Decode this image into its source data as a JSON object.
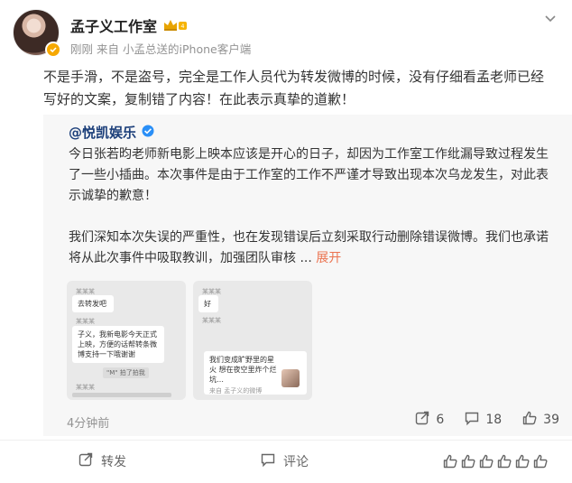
{
  "header": {
    "user_name": "孟子义工作室",
    "time": "刚刚",
    "source_prefix": "来自",
    "source": "小孟总送的iPhone客户端"
  },
  "post": {
    "text": "不是手滑，不是盗号，完全是工作人员代为转发微博的时候，没有仔细看孟老师已经写好的文案，复制错了内容！在此表示真挚的道歉！"
  },
  "repost": {
    "author": "@悦凯娱乐",
    "paragraph1": "今日张若昀老师新电影上映本应该是开心的日子，却因为工作室工作纰漏导致过程发生了一些小插曲。本次事件是由于工作室的工作不严谨才导致出现本次乌龙发生，对此表示诚挚的歉意！",
    "paragraph2_prefix": "我们深知本次失误的严重性，也在发现错误后立刻采取行动删除错误微博。我们也承诺将从此次事件中吸取教训，加强团队审核 ... ",
    "expand_label": "展开",
    "time": "4分钟前",
    "stats": {
      "reposts": "6",
      "comments": "18",
      "likes": "39"
    },
    "thumb1": {
      "label1": "某某某",
      "bubble1": "去转发吧",
      "label2": "某某某",
      "bubble2": "子义，我新电影今天正式上映，方便的话帮转条微博支持一下哦谢谢",
      "chip": "\"M\" 拍了拍我",
      "label3": "某某某"
    },
    "thumb2": {
      "label1": "某某某",
      "bubble1": "好",
      "label2": "某某某",
      "bubble2": "我们变成旷野里的星火 想在夜空里炸个烂坑…",
      "bubble2_sub": "来自 孟子义的微博"
    }
  },
  "footer": {
    "repost_label": "转发",
    "comment_label": "评论"
  },
  "colors": {
    "link": "#1c3f7a",
    "accent": "#eb7350",
    "meta": "#939393",
    "vip_badge": "#f6a800"
  }
}
